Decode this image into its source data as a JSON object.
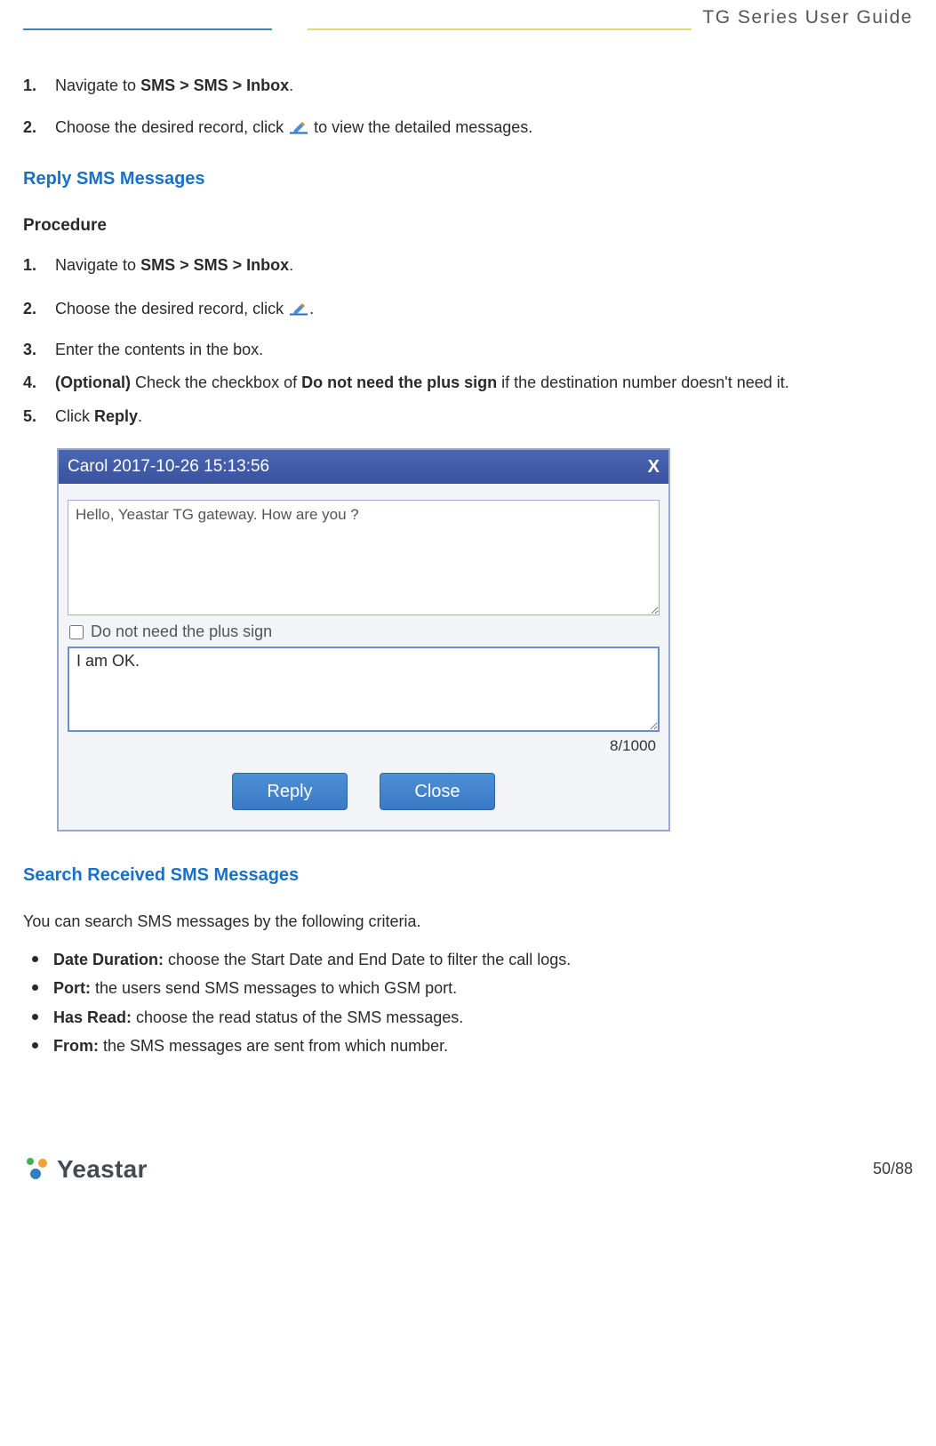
{
  "header": {
    "title": "TG  Series  User  Guide"
  },
  "sections": {
    "view": {
      "step1_pre": "Navigate to ",
      "step1_bold": "SMS > SMS > Inbox",
      "step1_post": ".",
      "step2_pre": "Choose the desired record, click ",
      "step2_post": " to view the detailed messages."
    },
    "reply": {
      "heading": "Reply SMS Messages",
      "procedure_label": "Procedure",
      "step1_pre": "Navigate to ",
      "step1_bold": "SMS > SMS > Inbox",
      "step1_post": ".",
      "step2_pre": "Choose the desired record, click ",
      "step2_post": ".",
      "step3": "Enter the contents in the box.",
      "step4_bold_a": "(Optional)",
      "step4_mid": " Check the checkbox of ",
      "step4_bold_b": "Do not need the plus sign",
      "step4_post": " if the destination number doesn't need it.",
      "step5_pre": "Click ",
      "step5_bold": "Reply",
      "step5_post": "."
    },
    "search": {
      "heading": "Search Received SMS Messages",
      "intro": "You can search SMS messages by the following criteria.",
      "items": [
        {
          "label": "Date Duration:",
          "desc": " choose the Start Date and End Date to filter the call logs."
        },
        {
          "label": "Port:",
          "desc": " the users send SMS messages to which GSM port."
        },
        {
          "label": "Has Read:",
          "desc": " choose the read status of the SMS messages."
        },
        {
          "label": "From:",
          "desc": " the SMS messages are sent from which number."
        }
      ]
    }
  },
  "dialog": {
    "title": "Carol 2017-10-26 15:13:56",
    "close": "X",
    "received_text": "Hello, Yeastar TG gateway. How are you ?",
    "checkbox_label": "Do not need the plus sign",
    "reply_text": "I am OK.",
    "counter": "8/1000",
    "btn_reply": "Reply",
    "btn_close": "Close"
  },
  "footer": {
    "logo_text": "Yeastar",
    "page": "50/88"
  },
  "step_numbers": [
    "1.",
    "2.",
    "3.",
    "4.",
    "5."
  ]
}
